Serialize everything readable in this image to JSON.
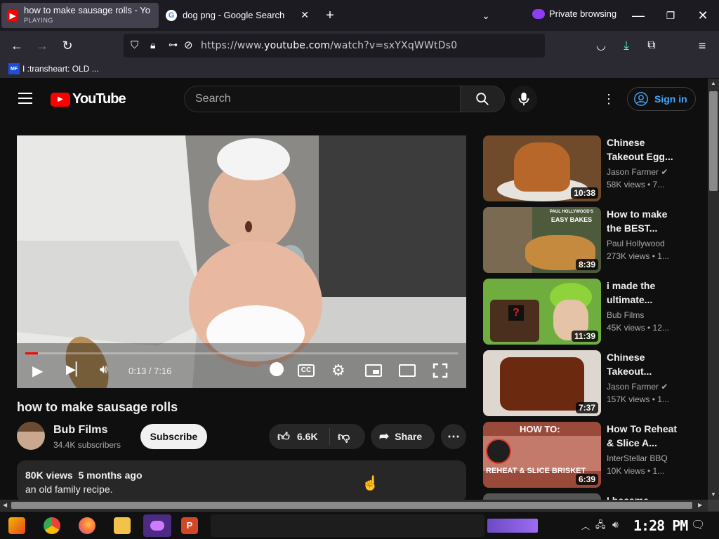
{
  "tabs": [
    {
      "title": "how to make sausage rolls - Yo",
      "status": "PLAYING"
    },
    {
      "title": "dog png - Google Search"
    }
  ],
  "private_label": "Private browsing",
  "url": {
    "prefix": "https://www.",
    "domain": "youtube.com",
    "path": "/watch?v=sxYXqWWtDs0"
  },
  "bookmark": {
    "label": "I :transheart: OLD ...",
    "icon_text": "MF"
  },
  "yt": {
    "logo_text": "YouTube",
    "search_placeholder": "Search",
    "signin_label": "Sign in"
  },
  "player": {
    "time": "0:13 / 7:16",
    "cc": "CC",
    "progress": 0.03
  },
  "video": {
    "title": "how to make sausage rolls",
    "channel": "Bub Films",
    "subscribers": "34.4K subscribers",
    "subscribe_label": "Subscribe",
    "likes": "6.6K",
    "share_label": "Share",
    "views_line": "80K views  5 months ago",
    "description": "an old family recipe."
  },
  "recommendations": [
    {
      "title1": "Chinese",
      "title2": "Takeout Egg...",
      "channel": "Jason Farmer",
      "verified": true,
      "views": "58K views  • 7...",
      "duration": "10:38"
    },
    {
      "title1": "How to make",
      "title2": "the BEST...",
      "channel": "Paul Hollywood",
      "verified": false,
      "views": "273K views  • 1...",
      "duration": "8:39",
      "thumb_text1": "PAUL HOLLYWOOD'S",
      "thumb_text2": "EASY BAKES"
    },
    {
      "title1": "i made the",
      "title2": "ultimate...",
      "channel": "Bub Films",
      "verified": false,
      "views": "45K views  • 12...",
      "duration": "11:39"
    },
    {
      "title1": "Chinese",
      "title2": "Takeout...",
      "channel": "Jason Farmer",
      "verified": true,
      "views": "157K views  • 1...",
      "duration": "7:37"
    },
    {
      "title1": "How To Reheat",
      "title2": "& Slice A...",
      "channel": "InterStellar BBQ",
      "verified": false,
      "views": "10K views  • 1...",
      "duration": "6:39",
      "thumb_text1": "HOW TO:",
      "thumb_text2": "REHEAT & SLICE BRISKET"
    },
    {
      "title1": "I became",
      "title2": "",
      "channel": "",
      "verified": false,
      "views": "",
      "duration": ""
    }
  ],
  "taskbar": {
    "clock": "1:28 PM"
  }
}
